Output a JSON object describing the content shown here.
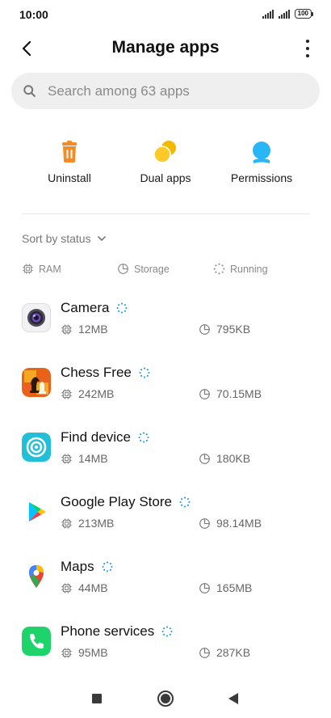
{
  "status_bar": {
    "time": "10:00",
    "battery": "100"
  },
  "header": {
    "title": "Manage apps"
  },
  "search": {
    "placeholder": "Search among 63 apps"
  },
  "actions": [
    {
      "label": "Uninstall",
      "icon": "trash-icon",
      "color": "#F28C28"
    },
    {
      "label": "Dual apps",
      "icon": "dual-circles-icon",
      "color": "#F5B800"
    },
    {
      "label": "Permissions",
      "icon": "person-icon",
      "color": "#29B6F6"
    }
  ],
  "sort": {
    "label": "Sort by status"
  },
  "legend": {
    "ram": "RAM",
    "storage": "Storage",
    "running": "Running"
  },
  "apps": [
    {
      "name": "Camera",
      "ram": "12MB",
      "storage": "795KB",
      "running": true,
      "icon": "camera-icon"
    },
    {
      "name": "Chess Free",
      "ram": "242MB",
      "storage": "70.15MB",
      "running": true,
      "icon": "chess-icon"
    },
    {
      "name": "Find device",
      "ram": "14MB",
      "storage": "180KB",
      "running": true,
      "icon": "find-device-icon"
    },
    {
      "name": "Google Play Store",
      "ram": "213MB",
      "storage": "98.14MB",
      "running": true,
      "icon": "play-store-icon"
    },
    {
      "name": "Maps",
      "ram": "44MB",
      "storage": "165MB",
      "running": true,
      "icon": "maps-pin-icon"
    },
    {
      "name": "Phone services",
      "ram": "95MB",
      "storage": "287KB",
      "running": true,
      "icon": "phone-icon"
    }
  ]
}
